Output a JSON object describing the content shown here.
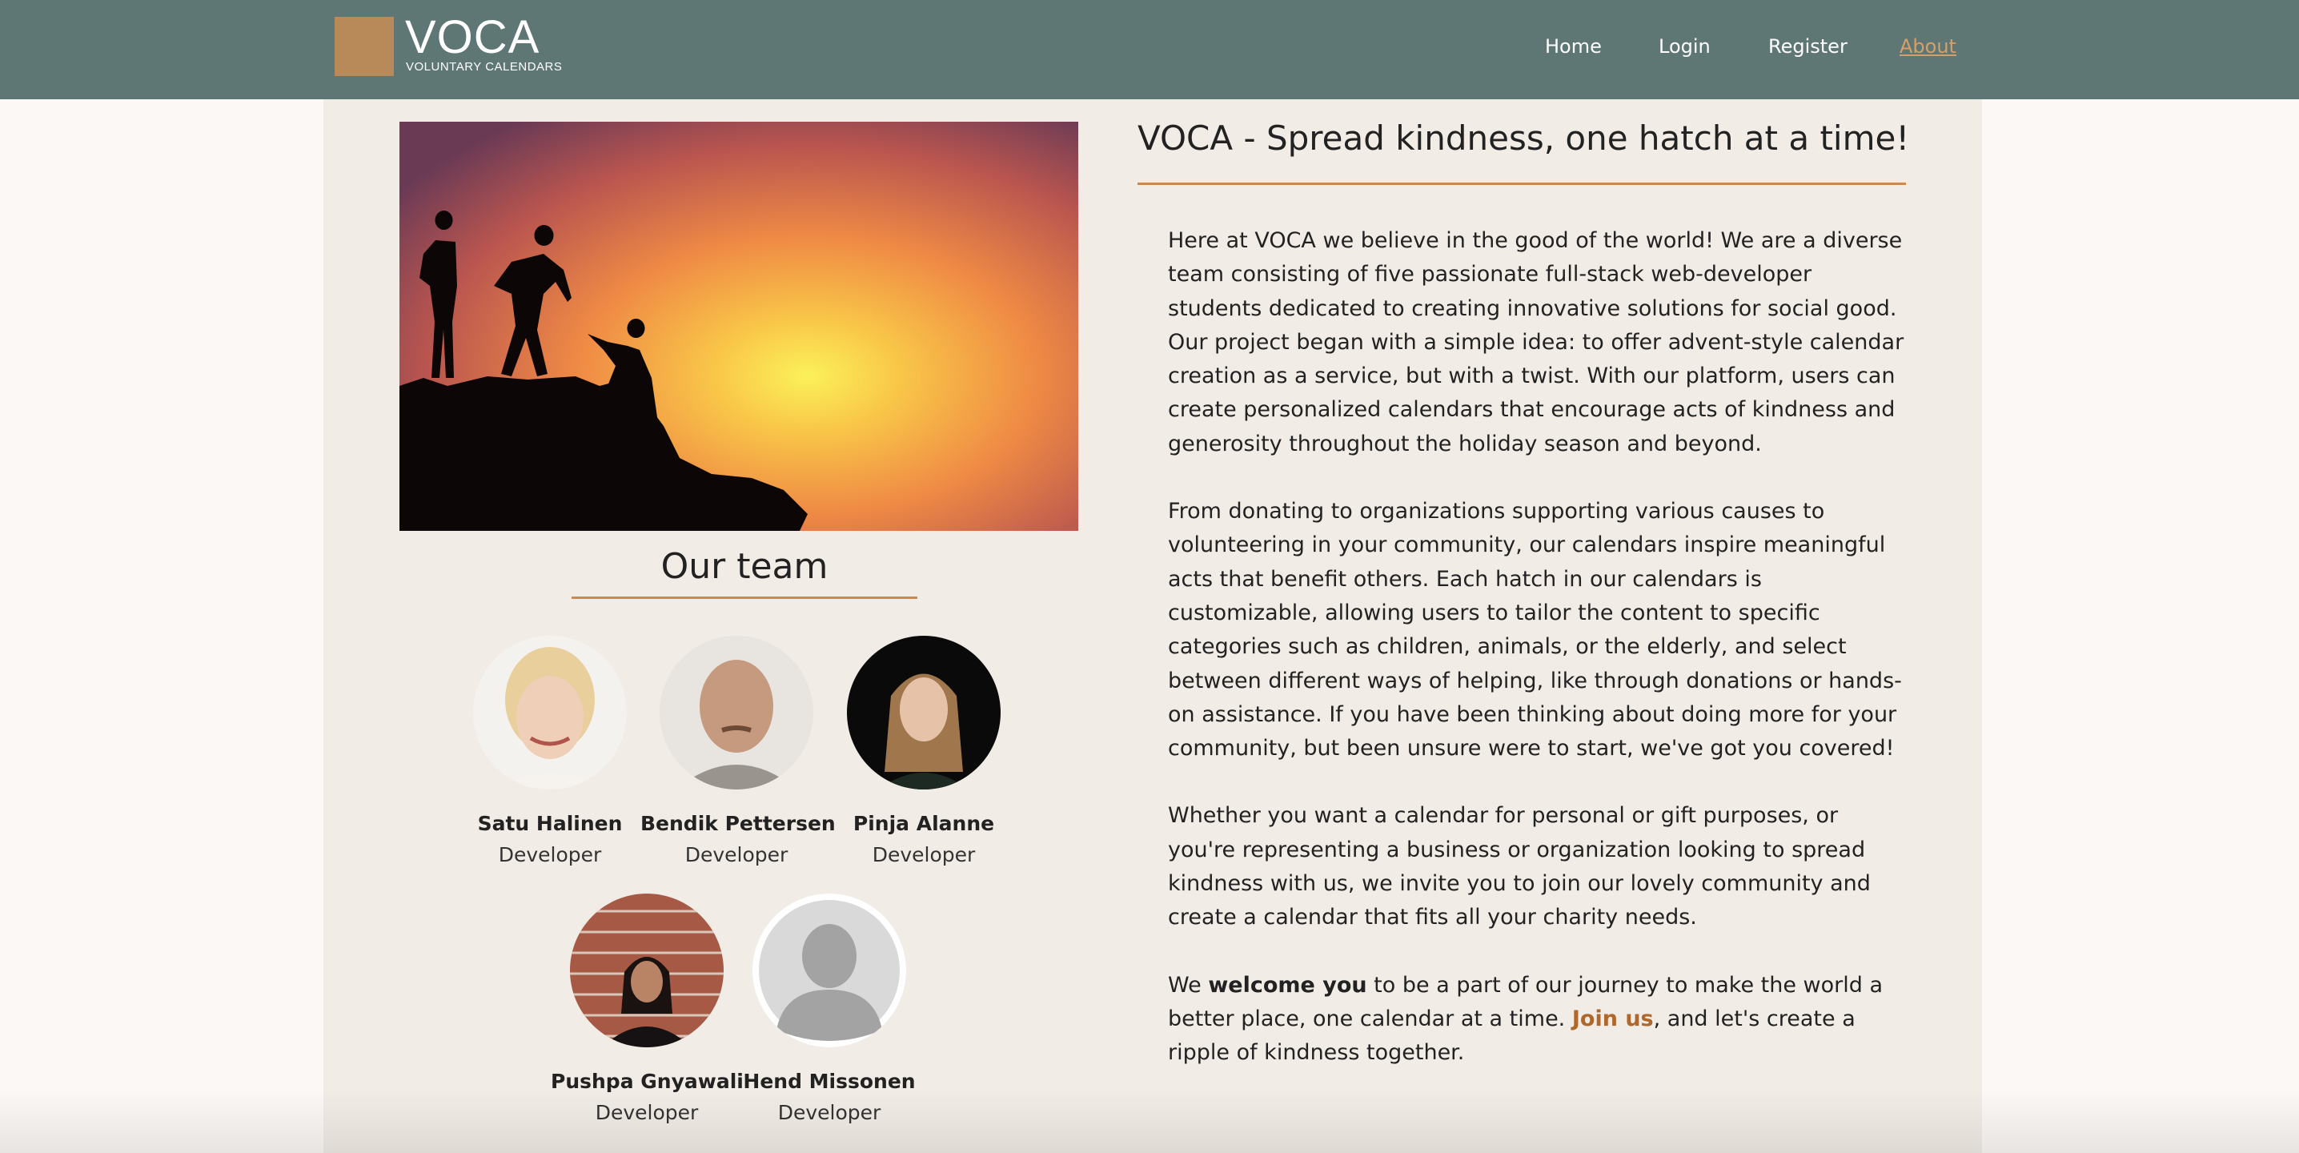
{
  "header": {
    "logo_title": "VOCA",
    "logo_subtitle": "VOLUNTARY CALENDARS",
    "nav": [
      {
        "label": "Home"
      },
      {
        "label": "Login"
      },
      {
        "label": "Register"
      },
      {
        "label": "About",
        "active": true
      }
    ]
  },
  "hero": {
    "icon": "climbers-sunset-image"
  },
  "team": {
    "heading": "Our team",
    "members": [
      {
        "name": "Satu Halinen",
        "role": "Developer"
      },
      {
        "name": "Bendik Pettersen",
        "role": "Developer"
      },
      {
        "name": "Pinja Alanne",
        "role": "Developer"
      },
      {
        "name": "Pushpa Gnyawali",
        "role": "Developer"
      },
      {
        "name": "Hend Missonen",
        "role": "Developer"
      }
    ]
  },
  "about": {
    "title": "VOCA - Spread kindness, one hatch at a time!",
    "p1": "Here at VOCA we believe in the good of the world! We are a diverse team consisting of five passionate full-stack web-developer students dedicated to creating innovative solutions for social good. Our project began with a simple idea: to offer advent-style calendar creation as a service, but with a twist. With our platform, users can create personalized calendars that encourage acts of kindness and generosity throughout the holiday season and beyond.",
    "p2": "From donating to organizations supporting various causes to volunteering in your community, our calendars inspire meaningful acts that benefit others. Each hatch in our calendars is customizable, allowing users to tailor the content to specific categories such as children, animals, or the elderly, and select between different ways of helping, like through donations or hands-on assistance. If you have been thinking about doing more for your community, but been unsure were to start, we've got you covered!",
    "p3": "Whether you want a calendar for personal or gift purposes, or you're representing a business or organization looking to spread kindness with us, we invite you to join our lovely community and create a calendar that fits all your charity needs.",
    "p4_pre": "We ",
    "p4_bold": "welcome you",
    "p4_mid": " to be a part of our journey to make the world a better place, one calendar at a time. ",
    "p4_link": "Join us",
    "p4_post": ", and let's create a ripple of kindness together."
  },
  "colors": {
    "header_bg": "#5f7774",
    "accent": "#c98950",
    "link": "#b0672a",
    "page_bg": "#fbf8f5",
    "card_bg": "#f1ece6"
  }
}
